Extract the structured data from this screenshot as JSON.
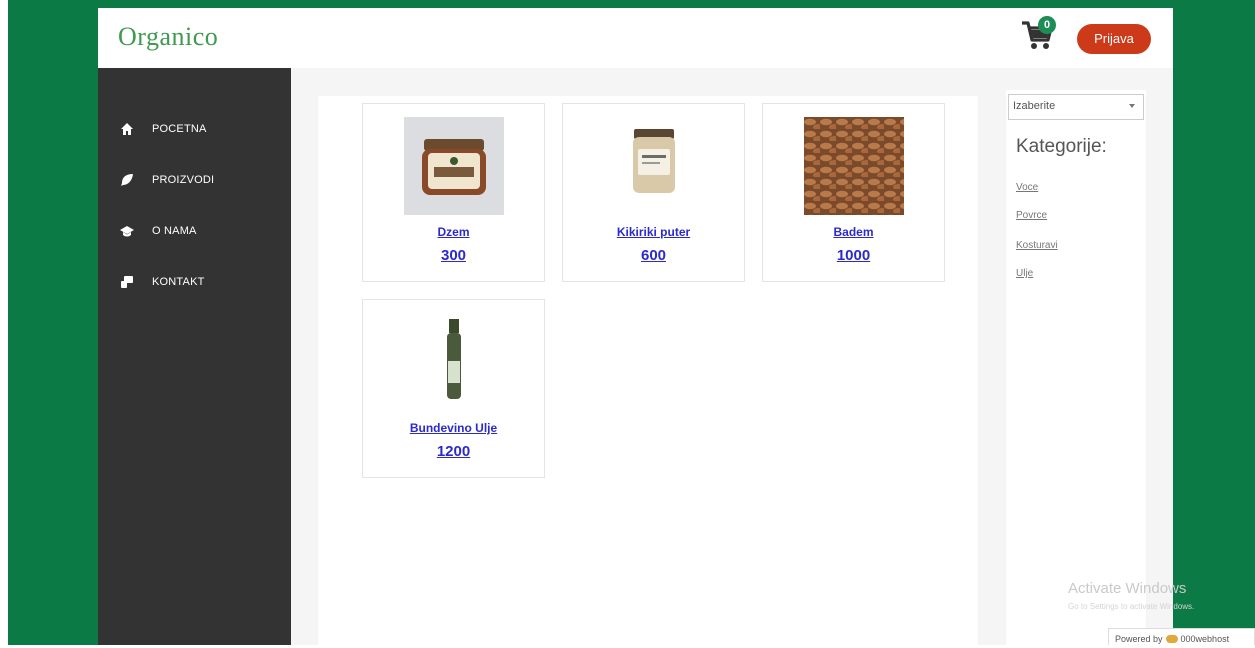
{
  "header": {
    "logo_text": "Organico",
    "cart": {
      "icon": "cart-icon",
      "count": "0"
    },
    "login_label": "Prijava"
  },
  "sidebar": {
    "items": [
      {
        "label": "POCETNA",
        "icon": "home-icon"
      },
      {
        "label": "PROIZVODI",
        "icon": "leaf-icon"
      },
      {
        "label": "O NAMA",
        "icon": "graduation-cap-icon"
      },
      {
        "label": "KONTAKT",
        "icon": "contact-icon"
      }
    ]
  },
  "products": [
    {
      "name": "Dzem",
      "price": "300",
      "image": "jam-jar-image"
    },
    {
      "name": "Kikiriki puter",
      "price": "600",
      "image": "peanut-butter-jar-image"
    },
    {
      "name": "Badem",
      "price": "1000",
      "image": "almonds-image"
    },
    {
      "name": "Bundevino Ulje",
      "price": "1200",
      "image": "oil-bottle-image"
    }
  ],
  "filter": {
    "select_value": "Izaberite",
    "heading": "Kategorije:",
    "categories": [
      "Voce",
      "Povrce",
      "Kosturavi",
      "Ulje"
    ]
  },
  "overlay": {
    "watermark_title": "Activate Windows",
    "watermark_sub": "Go to Settings to activate Windows.",
    "powered_text": "Powered by",
    "powered_brand": "000webhost"
  },
  "colors": {
    "brand_green": "#0b7a45",
    "sidebar_bg": "#333333",
    "login_red": "#cc3a1a",
    "link_blue": "#2b2bc9"
  }
}
